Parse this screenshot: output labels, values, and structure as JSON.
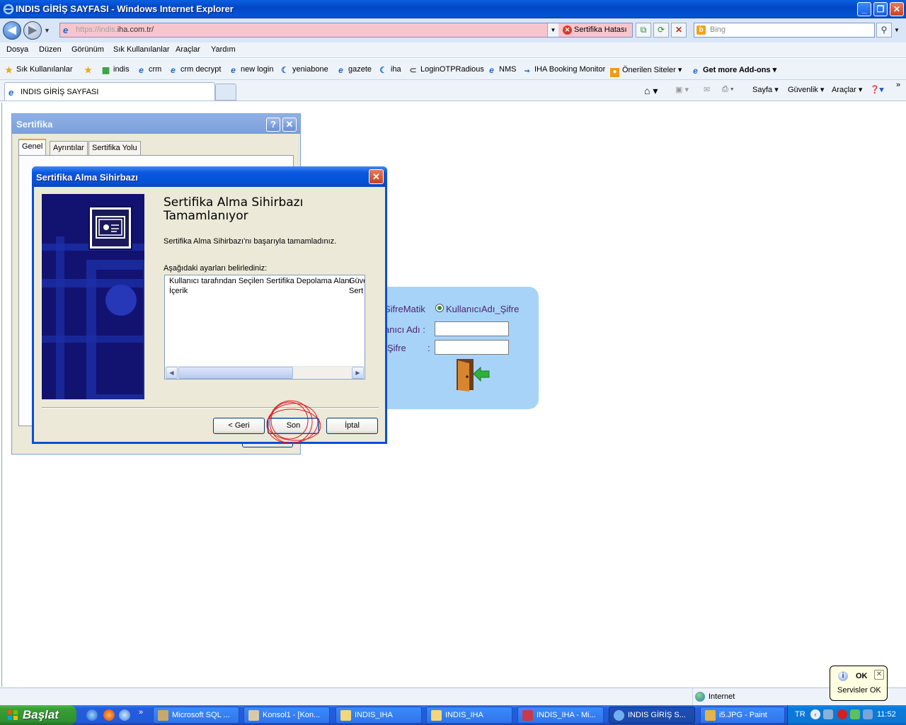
{
  "window": {
    "title": "INDIS GİRİŞ SAYFASI - Windows Internet Explorer"
  },
  "address_bar": {
    "url_prefix": "https://indis.",
    "url_domain": "iha.com.tr/",
    "cert_error": "Sertifika Hatası",
    "search_placeholder": "Bing"
  },
  "menu": [
    "Dosya",
    "Düzen",
    "Görünüm",
    "Sık Kullanılanlar",
    "Araçlar",
    "Yardım"
  ],
  "favorites_bar": {
    "favorites_label": "Sık Kullanılanlar",
    "items": [
      "indis",
      "crm",
      "crm decrypt",
      "new login",
      "yeniabone",
      "gazete",
      "iha",
      "LoginOTPRadious",
      "NMS",
      "IHA Booking Monitor",
      "Önerilen Siteler",
      "Get more Add-ons"
    ]
  },
  "tab": {
    "label": "INDIS GİRİŞ SAYFASI"
  },
  "command_bar": {
    "page": "Sayfa",
    "safety": "Güvenlik",
    "tools": "Araçlar"
  },
  "login_panel": {
    "option_sifrematik": "SifreMatik",
    "option_user": "KullanıcıAdı_Şifre",
    "user_label": "anıcı Adı :",
    "password_label": "Şifre",
    "password_colon": ":"
  },
  "cert_dialog": {
    "title": "Sertifika",
    "tabs": [
      "Genel",
      "Ayrıntılar",
      "Sertifika Yolu"
    ]
  },
  "wizard": {
    "title": "Sertifika Alma Sihirbazı",
    "heading": "Sertifika Alma Sihirbazı Tamamlanıyor",
    "message": "Sertifika Alma Sihirbazı'nı başarıyla tamamladınız.",
    "settings_label": "Aşağıdaki ayarları belirlediniz:",
    "settings": [
      {
        "name": "Kullanıcı tarafından Seçilen Sertifika Depolama Alanı",
        "value": "Güve"
      },
      {
        "name": "İçerik",
        "value": "Sert"
      }
    ],
    "buttons": {
      "back": "< Geri",
      "finish": "Son",
      "cancel": "İptal"
    }
  },
  "status_bar": {
    "zone": "Internet"
  },
  "balloon": {
    "title": "OK",
    "message": "Servisler OK"
  },
  "taskbar": {
    "start": "Başlat",
    "items": [
      "Microsoft SQL ...",
      "Konsol1 - [Kon...",
      "INDIS_IHA",
      "INDIS_IHA",
      "INDIS_IHA - Mi...",
      "INDIS GİRİŞ S...",
      "i5.JPG - Paint"
    ],
    "lang": "TR",
    "time": "11:52"
  },
  "colors": {
    "titlebar": "#0247c7",
    "address_error": "#f7c6cc",
    "login_panel": "#a8d3f8",
    "taskbar": "#245edc",
    "start": "#389e35"
  }
}
